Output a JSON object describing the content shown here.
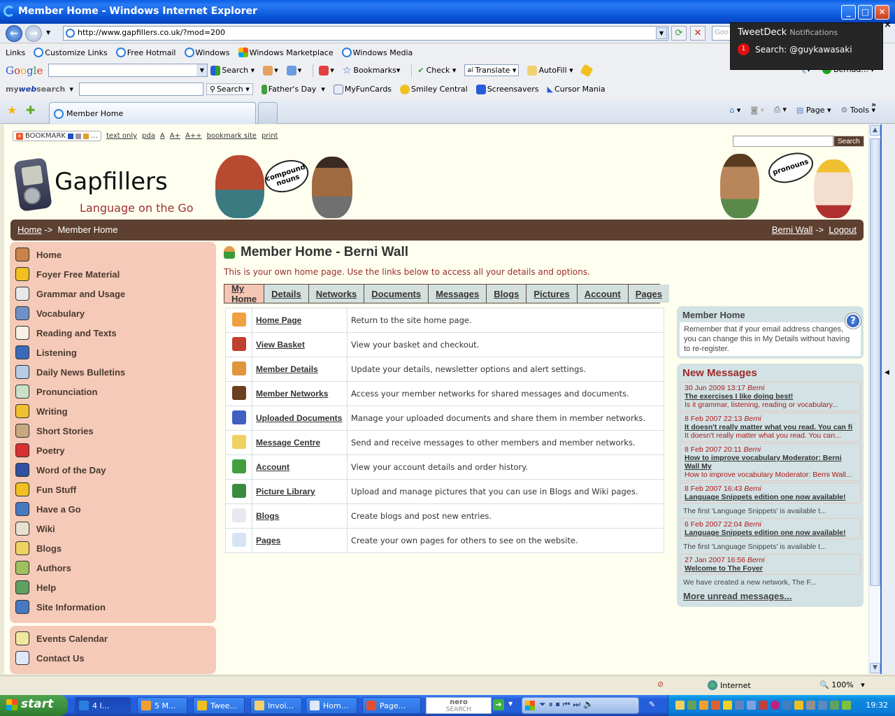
{
  "window": {
    "title": "Member Home - Windows Internet Explorer",
    "minimize": "_",
    "maximize": "□",
    "close": "✕"
  },
  "address_bar": {
    "url": "http://www.gapfillers.co.uk/?mod=200",
    "back": "←",
    "forward": "→",
    "refresh": "⟳",
    "stop": "✕",
    "search_placeholder": "Goo"
  },
  "links_bar": {
    "label": "Links",
    "items": [
      "Customize Links",
      "Free Hotmail",
      "Windows",
      "Windows Marketplace",
      "Windows Media"
    ]
  },
  "google_bar": {
    "logo": "Google",
    "search": "Search",
    "bookmarks": "Bookmarks",
    "check": "Check",
    "translate": "Translate",
    "autofill": "AutoFill",
    "user": "Bernad..."
  },
  "mywebsearch_bar": {
    "logo_prefix": "my",
    "logo_mid": "web",
    "logo_suffix": "search",
    "search": "Search",
    "items": [
      "Father's Day",
      "MyFunCards",
      "Smiley Central",
      "Screensavers",
      "Cursor Mania"
    ]
  },
  "tabs": {
    "active_tab": "Member Home"
  },
  "command_bar": {
    "page": "Page",
    "tools": "Tools",
    "more": "»"
  },
  "tweetdeck": {
    "app": "TweetDeck",
    "title_suffix": "Notifications",
    "count": "1",
    "text": "Search: @guykawasaki",
    "close": "×"
  },
  "page": {
    "topline": {
      "bookmark": "BOOKMARK",
      "links": [
        "text only",
        "pda",
        "A",
        "A+",
        "A++",
        "bookmark site",
        "print"
      ]
    },
    "site_search_button": "Search",
    "site_name": "Gapfillers",
    "tagline": "Language on the Go",
    "bubble_left": "compound nouns",
    "bubble_right": "pronouns",
    "breadcrumb": {
      "home": "Home",
      "sep": "->",
      "current": "Member Home",
      "user": "Berni Wall",
      "logout": "Logout"
    },
    "sidebar": [
      {
        "label": "Home",
        "color": "#c8844a"
      },
      {
        "label": "Foyer Free Material",
        "color": "#f0c020"
      },
      {
        "label": "Grammar and Usage",
        "color": "#e8e8e8"
      },
      {
        "label": "Vocabulary",
        "color": "#7090c8"
      },
      {
        "label": "Reading and Texts",
        "color": "#f8f0e4"
      },
      {
        "label": "Listening",
        "color": "#3a6ab8"
      },
      {
        "label": "Daily News Bulletins",
        "color": "#b8cce8"
      },
      {
        "label": "Pronunciation",
        "color": "#c8e0c8"
      },
      {
        "label": "Writing",
        "color": "#f0c030"
      },
      {
        "label": "Short Stories",
        "color": "#c8a880"
      },
      {
        "label": "Poetry",
        "color": "#d83030"
      },
      {
        "label": "Word of the Day",
        "color": "#3050a0"
      },
      {
        "label": "Fun Stuff",
        "color": "#f0c020"
      },
      {
        "label": "Have a Go",
        "color": "#4878c0"
      },
      {
        "label": "Wiki",
        "color": "#e8e0d0"
      },
      {
        "label": "Blogs",
        "color": "#f0d060"
      },
      {
        "label": "Authors",
        "color": "#a0c060"
      },
      {
        "label": "Help",
        "color": "#60a060"
      },
      {
        "label": "Site Information",
        "color": "#4878c0"
      }
    ],
    "sidebar2": [
      {
        "label": "Events Calendar",
        "color": "#f0e8a0"
      },
      {
        "label": "Contact Us",
        "color": "#e0e8f8"
      }
    ],
    "main": {
      "title": "Member Home - Berni Wall",
      "intro": "This is your own home page. Use the links below to access all your details and options.",
      "tabs": [
        "My Home",
        "Details",
        "Networks",
        "Documents",
        "Messages",
        "Blogs",
        "Pictures",
        "Account",
        "Pages"
      ],
      "rows": [
        {
          "icon": "home-icon",
          "color": "#f0a040",
          "link": "Home Page",
          "desc": "Return to the site home page."
        },
        {
          "icon": "basket-icon",
          "color": "#c04030",
          "link": "View Basket",
          "desc": "View your basket and checkout."
        },
        {
          "icon": "user-edit-icon",
          "color": "#e0943c",
          "link": "Member Details",
          "desc": "Update your details, newsletter options and alert settings."
        },
        {
          "icon": "users-icon",
          "color": "#6a4020",
          "link": "Member Networks",
          "desc": "Access your member networks for shared messages and documents."
        },
        {
          "icon": "documents-icon",
          "color": "#4060c0",
          "link": "Uploaded Documents",
          "desc": "Manage your uploaded documents and share them in member networks."
        },
        {
          "icon": "message-icon",
          "color": "#f0d060",
          "link": "Message Centre",
          "desc": "Send and receive messages to other members and member networks."
        },
        {
          "icon": "account-icon",
          "color": "#40a040",
          "link": "Account",
          "desc": "View your account details and order history."
        },
        {
          "icon": "picture-icon",
          "color": "#3a8a40",
          "link": "Picture Library",
          "desc": "Upload and manage pictures that you can use in Blogs and Wiki pages."
        },
        {
          "icon": "calendar-icon",
          "color": "#e8e8f0",
          "link": "Blogs",
          "desc": "Create blogs and post new entries."
        },
        {
          "icon": "page-icon",
          "color": "#d8e4f4",
          "link": "Pages",
          "desc": "Create your own pages for others to see on the website."
        }
      ]
    },
    "info_box": {
      "title": "Member Home",
      "help": "?",
      "text": "Remember that if your email address changes, you can change this in My Details without having to re-register."
    },
    "messages": {
      "title": "New Messages",
      "items": [
        {
          "date": "30 Jun 2009 13:17",
          "author": "Berni",
          "subject": "The exercises I like doing best!",
          "excerpt": "Is it grammar, listening, reading or vocabulary...",
          "excerpt_inside": true
        },
        {
          "date": "8 Feb 2007 22:13",
          "author": "Berni",
          "subject": "It doesn't really matter what you read. You can fi",
          "excerpt": "It doesn't really matter what you read. You can...",
          "excerpt_inside": true
        },
        {
          "date": "8 Feb 2007 20:11",
          "author": "Berni",
          "subject": "How to improve vocabulary Moderator: Berni Wall My",
          "excerpt": "How to improve vocabulary Moderator: Berni Wall...",
          "excerpt_inside": true
        },
        {
          "date": "8 Feb 2007 16:43",
          "author": "Berni",
          "subject": "Language Snippets edition one now available!",
          "excerpt": "The first 'Language Snippets' is available t...",
          "excerpt_inside": false
        },
        {
          "date": "6 Feb 2007 22:04",
          "author": "Berni",
          "subject": "Language Snippets edition one now available!",
          "excerpt": "The first 'Language Snippets' is available t...",
          "excerpt_inside": false
        },
        {
          "date": "27 Jan 2007 16:56",
          "author": "Berni",
          "subject": "Welcome to The Foyer",
          "excerpt": "We have created a new network, The F...",
          "excerpt_inside": false
        }
      ],
      "more": "More unread messages..."
    }
  },
  "status_bar": {
    "zone": "Internet",
    "zoom": "100%"
  },
  "taskbar": {
    "start": "start",
    "tasks": [
      {
        "label": "4 I...",
        "color": "#2b7de0",
        "active": true
      },
      {
        "label": "5 M...",
        "color": "#f0a030",
        "active": false
      },
      {
        "label": "Twee...",
        "color": "#f0c020",
        "active": false
      },
      {
        "label": "Invoi...",
        "color": "#f0d070",
        "active": false
      },
      {
        "label": "Hom...",
        "color": "#e0e8f8",
        "active": false
      },
      {
        "label": "Page...",
        "color": "#e05030",
        "active": false
      }
    ],
    "nero_line1": "nero",
    "nero_line2": "SEARCH",
    "clock": "19:32"
  }
}
